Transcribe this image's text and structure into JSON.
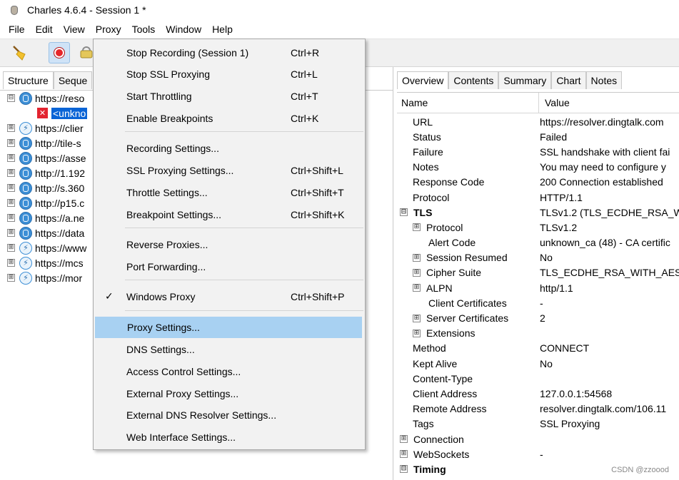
{
  "window": {
    "title": "Charles 4.6.4 - Session 1 *"
  },
  "menubar": [
    "File",
    "Edit",
    "View",
    "Proxy",
    "Tools",
    "Window",
    "Help"
  ],
  "left_tabs": [
    "Structure",
    "Seque"
  ],
  "tree": [
    {
      "icon": "globe",
      "expander": "⊟",
      "label": "https://reso"
    },
    {
      "icon": "error",
      "expander": "",
      "label": "<unkno",
      "selected": true
    },
    {
      "icon": "bolt",
      "expander": "⊞",
      "label": "https://clier"
    },
    {
      "icon": "globe",
      "expander": "⊞",
      "label": "http://tile-s"
    },
    {
      "icon": "globe",
      "expander": "⊞",
      "label": "https://asse"
    },
    {
      "icon": "globe",
      "expander": "⊞",
      "label": "http://1.192"
    },
    {
      "icon": "globe",
      "expander": "⊞",
      "label": "http://s.360"
    },
    {
      "icon": "globe",
      "expander": "⊞",
      "label": "http://p15.c"
    },
    {
      "icon": "globe",
      "expander": "⊞",
      "label": "https://a.ne"
    },
    {
      "icon": "globe",
      "expander": "⊞",
      "label": "https://data"
    },
    {
      "icon": "bolt",
      "expander": "⊞",
      "label": "https://www"
    },
    {
      "icon": "bolt",
      "expander": "⊞",
      "label": "https://mcs"
    },
    {
      "icon": "bolt",
      "expander": "⊞",
      "label": "https://mor"
    }
  ],
  "proxy_menu": {
    "items": [
      {
        "label": "Stop Recording (Session 1)",
        "shortcut": "Ctrl+R"
      },
      {
        "label": "Stop SSL Proxying",
        "shortcut": "Ctrl+L"
      },
      {
        "label": "Start Throttling",
        "shortcut": "Ctrl+T"
      },
      {
        "label": "Enable Breakpoints",
        "shortcut": "Ctrl+K"
      },
      {
        "label": "Recording Settings...",
        "shortcut": ""
      },
      {
        "label": "SSL Proxying Settings...",
        "shortcut": "Ctrl+Shift+L"
      },
      {
        "label": "Throttle Settings...",
        "shortcut": "Ctrl+Shift+T"
      },
      {
        "label": "Breakpoint Settings...",
        "shortcut": "Ctrl+Shift+K"
      },
      {
        "label": "Reverse Proxies...",
        "shortcut": ""
      },
      {
        "label": "Port Forwarding...",
        "shortcut": ""
      },
      {
        "label": "Windows Proxy",
        "shortcut": "Ctrl+Shift+P",
        "checked": "✓"
      },
      {
        "label": "Proxy Settings...",
        "shortcut": "",
        "highlighted": true
      },
      {
        "label": "DNS Settings...",
        "shortcut": ""
      },
      {
        "label": "Access Control Settings...",
        "shortcut": ""
      },
      {
        "label": "External Proxy Settings...",
        "shortcut": ""
      },
      {
        "label": "External DNS Resolver Settings...",
        "shortcut": ""
      },
      {
        "label": "Web Interface Settings...",
        "shortcut": ""
      }
    ]
  },
  "right_tabs": [
    "Overview",
    "Contents",
    "Summary",
    "Chart",
    "Notes"
  ],
  "columns": {
    "name": "Name",
    "value": "Value"
  },
  "properties": [
    {
      "name": "URL",
      "value": "https://resolver.dingtalk.com",
      "indent": 1,
      "expander": ""
    },
    {
      "name": "Status",
      "value": "Failed",
      "indent": 1,
      "expander": ""
    },
    {
      "name": "Failure",
      "value": "SSL handshake with client fai",
      "indent": 1,
      "expander": ""
    },
    {
      "name": "Notes",
      "value": "You may need to configure y",
      "indent": 1,
      "expander": ""
    },
    {
      "name": "Response Code",
      "value": "200 Connection established",
      "indent": 1,
      "expander": ""
    },
    {
      "name": "Protocol",
      "value": "HTTP/1.1",
      "indent": 1,
      "expander": ""
    },
    {
      "name": "TLS",
      "value": "TLSv1.2 (TLS_ECDHE_RSA_WI",
      "indent": 0,
      "expander": "⊟",
      "bold": true
    },
    {
      "name": "Protocol",
      "value": "TLSv1.2",
      "indent": 2,
      "expander": "⊞"
    },
    {
      "name": "Alert Code",
      "value": "unknown_ca (48) - CA certific",
      "indent": 3,
      "expander": ""
    },
    {
      "name": "Session Resumed",
      "value": "No",
      "indent": 2,
      "expander": "⊞"
    },
    {
      "name": "Cipher Suite",
      "value": "TLS_ECDHE_RSA_WITH_AES_1",
      "indent": 2,
      "expander": "⊞"
    },
    {
      "name": "ALPN",
      "value": "http/1.1",
      "indent": 2,
      "expander": "⊞"
    },
    {
      "name": "Client Certificates",
      "value": "-",
      "indent": 3,
      "expander": ""
    },
    {
      "name": "Server Certificates",
      "value": "2",
      "indent": 2,
      "expander": "⊞"
    },
    {
      "name": "Extensions",
      "value": "",
      "indent": 2,
      "expander": "⊞"
    },
    {
      "name": "Method",
      "value": "CONNECT",
      "indent": 1,
      "expander": ""
    },
    {
      "name": "Kept Alive",
      "value": "No",
      "indent": 1,
      "expander": ""
    },
    {
      "name": "Content-Type",
      "value": "",
      "indent": 1,
      "expander": ""
    },
    {
      "name": "Client Address",
      "value": "127.0.0.1:54568",
      "indent": 1,
      "expander": ""
    },
    {
      "name": "Remote Address",
      "value": "resolver.dingtalk.com/106.11",
      "indent": 1,
      "expander": ""
    },
    {
      "name": "Tags",
      "value": "SSL Proxying",
      "indent": 1,
      "expander": ""
    },
    {
      "name": "Connection",
      "value": "",
      "indent": 0,
      "expander": "⊞"
    },
    {
      "name": "WebSockets",
      "value": "-",
      "indent": 0,
      "expander": "⊞"
    },
    {
      "name": "Timing",
      "value": "",
      "indent": 0,
      "expander": "⊟",
      "bold": true
    }
  ],
  "watermark": "CSDN @zzoood"
}
